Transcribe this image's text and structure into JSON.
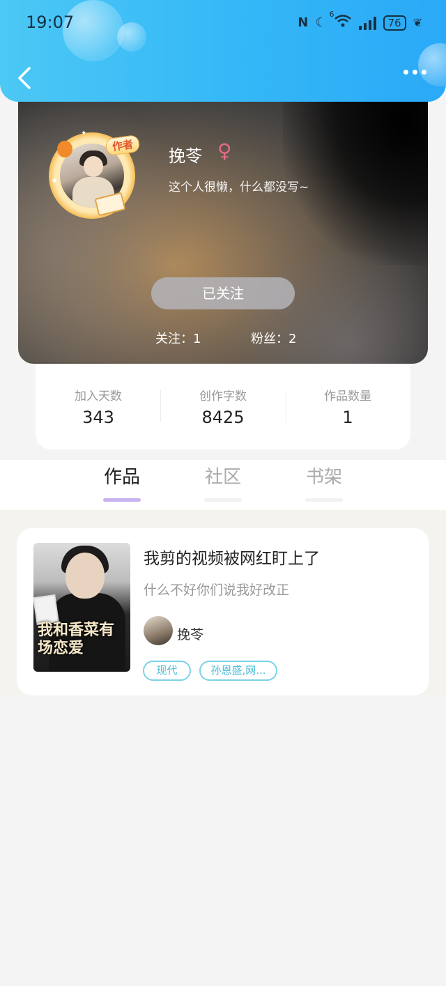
{
  "status_bar": {
    "time": "19:07",
    "nfc": "N",
    "network_sup": "6",
    "battery": "76"
  },
  "profile": {
    "name": "挽苓",
    "gender_symbol": "♀",
    "bio": "这个人很懒，什么都没写~",
    "avatar_badge": "作者",
    "follow_button": "已关注",
    "following": "关注：1",
    "followers": "粉丝：2"
  },
  "stats": [
    {
      "label": "加入天数",
      "value": "343"
    },
    {
      "label": "创作字数",
      "value": "8425"
    },
    {
      "label": "作品数量",
      "value": "1"
    }
  ],
  "tabs": [
    {
      "label": "作品",
      "active": true
    },
    {
      "label": "社区",
      "active": false
    },
    {
      "label": "书架",
      "active": false
    }
  ],
  "works": [
    {
      "title": "我剪的视频被网红盯上了",
      "description": "什么不好你们说我好改正",
      "author": "挽苓",
      "cover_title": "我和香菜有场恋爱",
      "tags": [
        "现代",
        "孙恩盛,网..."
      ]
    }
  ],
  "colors": {
    "header": "#34b7f7",
    "tab_active_bar": "#c7b3f0",
    "tag": "#49bcd6",
    "gender": "#e56a8a"
  }
}
